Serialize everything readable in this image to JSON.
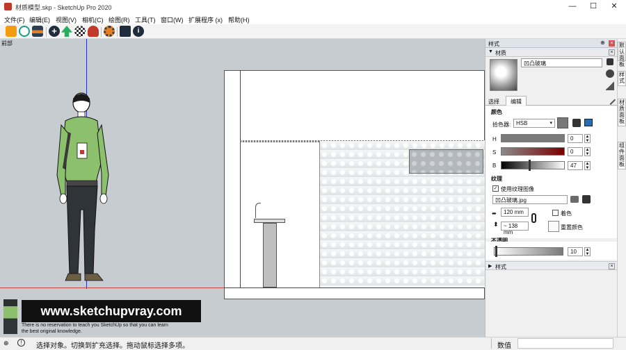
{
  "window": {
    "title": "材质模型.skp - SketchUp Pro 2020",
    "controls": [
      "—",
      "☐",
      "✕"
    ]
  },
  "menu": [
    "文件(F)",
    "编辑(E)",
    "视图(V)",
    "相机(C)",
    "绘图(R)",
    "工具(T)",
    "窗口(W)",
    "扩展程序 (x)",
    "帮助(H)"
  ],
  "viewport": {
    "scene_tab": "前部",
    "watermark_url": "www.sketchupvray.com",
    "watermark_line1": "There is no reservation to teach you SketchUp so that you can learn",
    "watermark_line2": "the best original knowledge."
  },
  "panel": {
    "title": "样式",
    "materials_section": "材质",
    "material_name": "凹凸玻璃",
    "tabs": [
      "选择",
      "编辑"
    ],
    "color_heading": "颜色",
    "picker_label": "拾色器:",
    "picker_value": "HSB",
    "h_label": "H",
    "h_value": "0",
    "s_label": "S",
    "s_value": "0",
    "b_label": "B",
    "b_value": "47",
    "texture_heading": "纹理",
    "use_texture_label": "使用纹理图像",
    "texture_file": "凹凸玻璃.jpg",
    "width_value": "120 mm",
    "height_value": "~ 138 mm",
    "colorize_label": "着色",
    "reset_color_label": "重置颜色",
    "opacity_heading": "不透明",
    "opacity_value": "10",
    "styles_section": "样式"
  },
  "right_tabs": [
    "默认面板",
    "样式",
    "材质面板",
    "组件面板"
  ],
  "status": {
    "message": "选择对象。切换到扩充选择。拖动鼠标选择多项。",
    "measure_label": "数值"
  },
  "colors": {
    "viewport_bg": "#c7ccd0",
    "panel_bg": "#f0f0f0",
    "panel_header": "#dfe3ea"
  }
}
